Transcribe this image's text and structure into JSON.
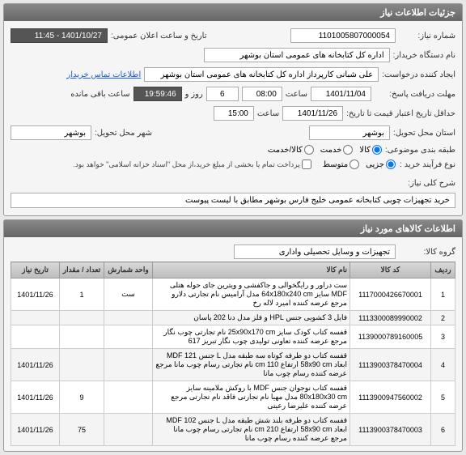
{
  "panels": {
    "need_info_title": "جزئیات اطلاعات نیاز"
  },
  "fields": {
    "need_number_label": "شماره نیاز:",
    "need_number": "1101005807000054",
    "announce_datetime_label": "تاریخ و ساعت اعلان عمومی:",
    "announce_datetime": "1401/10/27 - 11:45",
    "buyer_name_label": "نام دستگاه خریدار:",
    "buyer_name": "اداره کل کتابخانه های عمومی استان بوشهر",
    "creator_label": "ایجاد کننده درخواست:",
    "creator": "علی شبانی کارپرداز اداره کل کتابخانه های عمومی استان بوشهر",
    "contact_link": "اطلاعات تماس خریدار",
    "reply_deadline_label": "مهلت دریافت پاسخ:",
    "reply_deadline_date": "1401/11/04",
    "time_label": "ساعت",
    "reply_deadline_time": "08:00",
    "days_remaining_value": "6",
    "days_remaining_label1": "روز و",
    "days_remaining_time": "19:59:46",
    "days_remaining_label2": "ساعت باقی مانده",
    "validity_label": "حداقل تاریخ اعتبار قیمت تا تاریخ:",
    "validity_date": "1401/11/26",
    "validity_time": "15:00",
    "exec_province_label": "استان محل تحویل:",
    "exec_province": "بوشهر",
    "exec_city_label": "شهر محل تحویل:",
    "exec_city": "بوشهر",
    "subject_group_label": "طبقه بندی موضوعی:",
    "purchase_type_label": "نوع فرآیند خرید :",
    "partial_payment_label": "پرداخت تمام یا بخشی از مبلغ خرید،از محل \"اسناد خزانه اسلامی\" خواهد بود."
  },
  "radios": {
    "subject_kala": "کالا",
    "subject_khedmat": "خدمت",
    "subject_both": "کالا/خدمت",
    "process_small": "جزیی",
    "process_medium": "متوسط"
  },
  "description": {
    "label": "شرح کلی نیاز:",
    "value": "خرید تجهیزات چوبی کتابخانه عمومی خلیج فارس بوشهر مطابق با لیست پیوست"
  },
  "goods_panel": {
    "title": "اطلاعات کالاهای مورد نیاز",
    "group_label": "گروه کالا:",
    "group_value": "تجهیزات و وسایل تحصیلی واداری"
  },
  "table": {
    "headers": {
      "row": "ردیف",
      "code": "کد کالا",
      "name": "نام کالا",
      "unit": "واحد شمارش",
      "qty": "تعداد / مقدار",
      "date": "تاریخ نیاز"
    },
    "rows": [
      {
        "row": "1",
        "code": "1117000426670001",
        "name": "ست دراور و رایگخوالی و جاکفشی و ویترین جای حوله هتلی MDF سایز 64x180x240 cm مدل آرامیس نام تجارتی دلارو مرجع عرضه کننده امیرد لاله رخ",
        "unit": "ست",
        "qty": "1",
        "date": "1401/11/26"
      },
      {
        "row": "2",
        "code": "1113300089990002",
        "name": "فایل 3 کشویی جنس HPL و فلز مدل دنا 202 پاسان",
        "unit": "",
        "qty": "",
        "date": ""
      },
      {
        "row": "3",
        "code": "1139000789160005",
        "name": "قفسه کتاب کودک سایز 25x90x170 cm نام تجارتی چوب نگار مرجع عرضه کننده تعاونی تولیدی چوب نگار تبریز 617",
        "unit": "",
        "qty": "",
        "date": ""
      },
      {
        "row": "4",
        "code": "1113900378470004",
        "name": "قفسه کتاب دو طرفه کوتاه سه طبقه مدل L جنس MDF 121 ابعاد 58x90 cm ارتفاع 110 cm نام تجارتی رسام چوب مانا مرجع عرضه کننده رسام چوب مانا",
        "unit": "",
        "qty": "",
        "date": "1401/11/26"
      },
      {
        "row": "5",
        "code": "1113900947560002",
        "name": "قفسه کتاب نوجوان جنس MDF با روکش ملامینه سایز 80x180x30 cm مدل مهیا نام تجارتی فاقد نام تجارتی مرجع عرضه کننده علیرضا رعیتی",
        "unit": "",
        "qty": "9",
        "date": "1401/11/26"
      },
      {
        "row": "6",
        "code": "1113900378470003",
        "name": "قفسه کتاب دو طرفه بلند شش طبقه مدل L جنس MDF 102 ابعاد 58x90 cm ارتفاع 210 cm نام تجارتی رسام چوب مانا مرجع عرضه کننده رسام چوب مانا",
        "unit": "",
        "qty": "75",
        "date": "1401/11/26"
      }
    ]
  }
}
